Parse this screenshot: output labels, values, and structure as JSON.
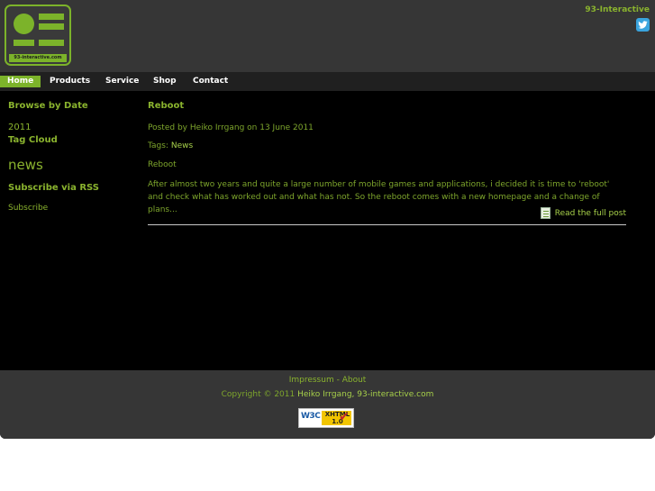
{
  "brand": {
    "logo_domain_text": "93-interactive.com",
    "site_name": "93-Interactive",
    "accent_color": "#7cb32a"
  },
  "social": {
    "icon": "twitter-icon"
  },
  "nav": {
    "items": [
      {
        "label": "Home",
        "active": true
      },
      {
        "label": "Products",
        "active": false
      },
      {
        "label": "Service",
        "active": false
      },
      {
        "label": "Shop",
        "active": false
      },
      {
        "label": "Contact",
        "active": false
      }
    ]
  },
  "sidebar": {
    "browse_heading": "Browse by Date",
    "year_link": "2011",
    "tag_cloud_heading": "Tag Cloud",
    "tag_cloud_tag": "news",
    "rss_heading": "Subscribe via RSS",
    "subscribe_link": "Subscribe"
  },
  "post": {
    "title": "Reboot",
    "meta": "Posted by Heiko Irrgang on 13 June 2011",
    "tags_label": "Tags:",
    "tag": "News",
    "subtitle": "Reboot",
    "excerpt": "After almost two years and quite a large number of mobile games and applications, i decided it is time to 'reboot' and check what has worked out and what has not. So the reboot comes with a new homepage and a change of plans...",
    "read_more": "Read the full post"
  },
  "footer": {
    "impressum": "Impressum",
    "separator": " - ",
    "about": "About",
    "copyright_prefix": "Copyright © 2011 ",
    "copyright_author": "Heiko Irrgang, 93-interactive.com",
    "badge_w3c": "W3C",
    "badge_xhtml": "XHTML",
    "badge_version": "1.0"
  }
}
